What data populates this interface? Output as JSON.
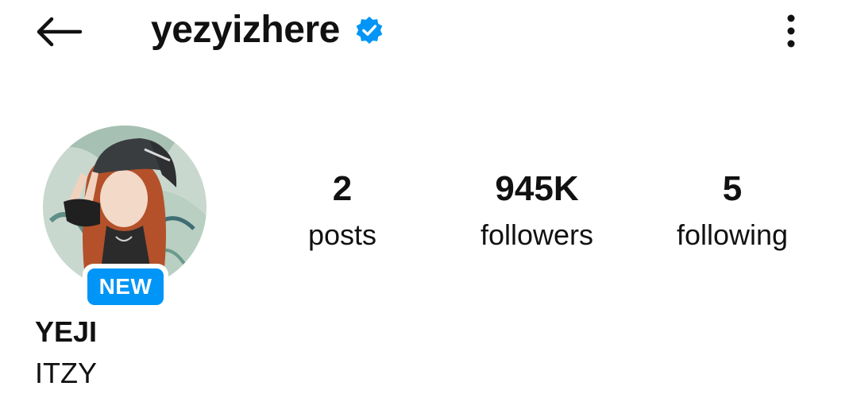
{
  "header": {
    "username": "yezyizhere",
    "back_icon": "arrow-left-icon",
    "verified_icon": "verified-badge-icon",
    "more_icon": "more-vertical-icon"
  },
  "profile": {
    "badge_label": "NEW",
    "display_name": "YEJI",
    "bio": "ITZY"
  },
  "stats": [
    {
      "count": "2",
      "label": "posts"
    },
    {
      "count": "945K",
      "label": "followers"
    },
    {
      "count": "5",
      "label": "following"
    }
  ],
  "colors": {
    "accent": "#0095f6",
    "text": "#111111",
    "background": "#ffffff"
  }
}
